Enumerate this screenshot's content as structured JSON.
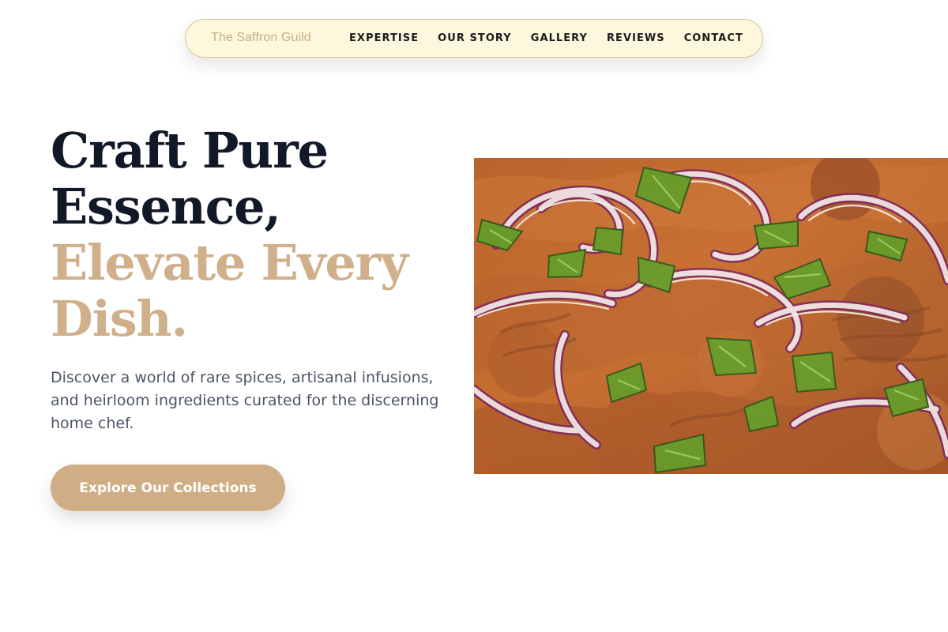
{
  "nav": {
    "brand": "The Saffron Guild",
    "links": [
      "EXPERTISE",
      "OUR STORY",
      "GALLERY",
      "REVIEWS",
      "CONTACT"
    ]
  },
  "hero": {
    "title_lines": [
      "Craft Pure",
      "Essence,",
      "Elevate Every",
      "Dish."
    ],
    "subtitle": "Discover a world of rare spices, artisanal infusions, and heirloom ingredients curated for the discerning home chef.",
    "button_label": "Explore Our Collections"
  },
  "colors": {
    "accent": "#d0b08b",
    "dark_text": "#111827",
    "nav_bg": "#fdf7dd"
  },
  "image": {
    "subject": "food-dish-with-red-onions-and-green-onions"
  }
}
